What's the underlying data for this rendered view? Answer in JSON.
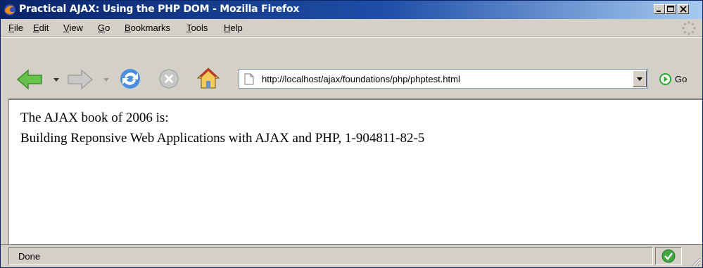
{
  "window": {
    "title": "Practical AJAX: Using the PHP DOM - Mozilla Firefox",
    "minimize_label": "_",
    "maximize_label": "□",
    "close_label": "X"
  },
  "menubar": {
    "items": [
      {
        "label": "File",
        "accel": "F",
        "rest": "ile"
      },
      {
        "label": "Edit",
        "accel": "E",
        "rest": "dit"
      },
      {
        "label": "View",
        "accel": "V",
        "rest": "iew"
      },
      {
        "label": "Go",
        "accel": "G",
        "rest": "o"
      },
      {
        "label": "Bookmarks",
        "accel": "B",
        "rest": "ookmarks"
      },
      {
        "label": "Tools",
        "accel": "T",
        "rest": "ools"
      },
      {
        "label": "Help",
        "accel": "H",
        "rest": "elp"
      }
    ]
  },
  "navbar": {
    "back_icon": "back-arrow-icon",
    "forward_icon": "forward-arrow-icon",
    "reload_icon": "reload-icon",
    "stop_icon": "stop-icon",
    "home_icon": "home-icon",
    "url": "http://localhost/ajax/foundations/php/phptest.html",
    "go_label": "Go"
  },
  "content": {
    "line1": "The AJAX book of 2006 is:",
    "line2": "Building Reponsive Web Applications with AJAX and PHP, 1-904811-82-5"
  },
  "statusbar": {
    "text": "Done"
  },
  "colors": {
    "titlebar_start": "#0a246a",
    "titlebar_end": "#a6caf0",
    "chrome": "#d4d0c8",
    "back_arrow": "#5fbf3f",
    "reload": "#2f6fd8",
    "go_icon": "#2fa82f"
  }
}
